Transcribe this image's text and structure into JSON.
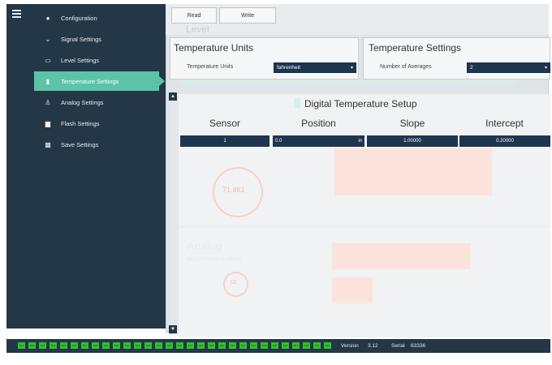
{
  "sidebar": {
    "items": [
      {
        "label": "Configuration",
        "icon": "gear-icon",
        "glyph": "●"
      },
      {
        "label": "Signal Settings",
        "icon": "chevron-down-icon",
        "glyph": "⌄"
      },
      {
        "label": "Level Settings",
        "icon": "display-icon",
        "glyph": "▭"
      },
      {
        "label": "Temperature Settings",
        "icon": "thermometer-icon",
        "glyph": "▮",
        "active": true
      },
      {
        "label": "Analog Settings",
        "icon": "person-icon",
        "glyph": "♙"
      },
      {
        "label": "Flash Settings",
        "icon": "chip-icon",
        "glyph": "▆"
      },
      {
        "label": "Save Settings",
        "icon": "floppy-icon",
        "glyph": "▩"
      }
    ]
  },
  "toolbar": {
    "read_label": "Read",
    "write_label": "Write"
  },
  "ghost": {
    "level_label": "Level"
  },
  "temperature_units": {
    "title": "Temperature Units",
    "field_label": "Temperature Units",
    "value": "fahrenheit"
  },
  "temperature_settings": {
    "title": "Temperature Settings",
    "field_label": "Number of Averages",
    "value": "2"
  },
  "digital": {
    "title": "Digital Temperature Setup",
    "columns": [
      "Sensor",
      "Position",
      "Slope",
      "Intercept"
    ],
    "row": {
      "sensor": "1",
      "position": "0.0",
      "unit": "in",
      "slope": "1.00000",
      "intercept": "0.20000"
    }
  },
  "background_ghost": {
    "temp_value": "71.461",
    "analog_title": "Analog",
    "analog_subtitle": "Output Current in mAmps",
    "gauge_value": "01"
  },
  "status": {
    "leds": [
      "501",
      "502",
      "503",
      "504",
      "505",
      "506",
      "507",
      "508",
      "509",
      "510",
      "511",
      "512",
      "513",
      "514",
      "515",
      "516",
      "517",
      "518",
      "519",
      "520",
      "521",
      "522",
      "523",
      "524",
      "525",
      "526",
      "527",
      "528",
      "529",
      "530"
    ],
    "version_label": "Version",
    "version_value": "3.12",
    "serial_label": "Serial",
    "serial_value": "63336"
  },
  "colors": {
    "sidebar": "#243747",
    "accent": "#5bc4a7",
    "input": "#1e3550",
    "led": "#2fc22f"
  }
}
